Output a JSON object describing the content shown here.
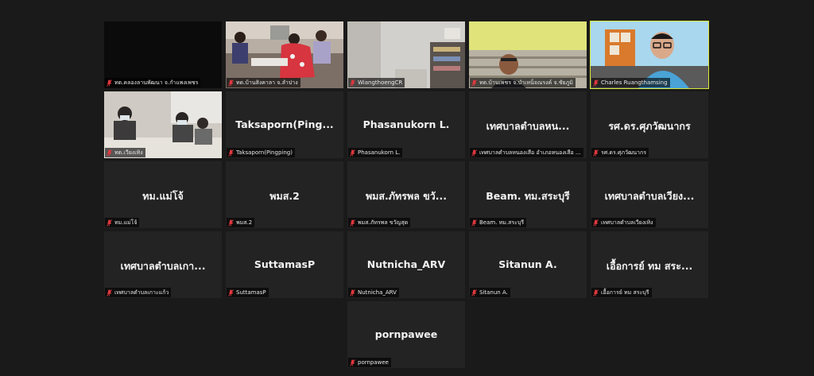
{
  "accent": {
    "speaking_border": "#d9e83a",
    "muted_mic": "#e0383e"
  },
  "participants": [
    {
      "label": "ทต.คลองลานพัฒนา จ.กำแพงเพชร",
      "video": "dark"
    },
    {
      "label": "ทต.บ้านสิงคาลา จ.ลำปาง",
      "video": "room"
    },
    {
      "label": "WiangthoengCR",
      "video": "office"
    },
    {
      "label": "ทต.บ้านเพชร จ.บำเหน็จณรงค์ จ.ชัยภูมิ",
      "video": "man-green-wall"
    },
    {
      "label": "Charles Ruangthamsing",
      "video": "man-glasses"
    },
    {
      "label": "ทต.เวียงเทิง",
      "video": "meeting-room"
    },
    {
      "display_name": "Taksaporn(Ping...",
      "label": "Taksaporn(Pingping)"
    },
    {
      "display_name": "Phasanukorn L.",
      "label": "Phasanukorn L."
    },
    {
      "display_name": "เทศบาลตำบลหน...",
      "label": "เทศบาลตำบลหนองเสือ อำเภอหนองเสือ ..."
    },
    {
      "display_name": "รศ.ดร.ศุภวัฒนากร",
      "label": "รศ.ดร.ศุภวัฒนากร"
    },
    {
      "display_name": "ทม.แม่โจ้",
      "label": "ทม.แม่โจ้"
    },
    {
      "display_name": "พมส.2",
      "label": "พมส.2"
    },
    {
      "display_name": "พมส.ภัทรพล ขวั...",
      "label": "พมส.ภัทรพล ขวัญสุด"
    },
    {
      "display_name": "Beam. ทม.สระบุรี",
      "label": "Beam. ทม.สระบุรี"
    },
    {
      "display_name": "เทศบาลตำบลเวียง...",
      "label": "เทศบาลตำบลเวียงเทิง"
    },
    {
      "display_name": "เทศบาลตำบลเกา...",
      "label": "เทศบาลตำบลเกาะแก้ว"
    },
    {
      "display_name": "SuttamasP",
      "label": "SuttamasP"
    },
    {
      "display_name": "Nutnicha_ARV",
      "label": "Nutnicha_ARV"
    },
    {
      "display_name": "Sitanun A.",
      "label": "Sitanun A."
    },
    {
      "display_name": "เอื้อการย์ ทม สระ...",
      "label": "เอื้อการย์ ทม สระบุรี"
    },
    {
      "display_name": "pornpawee",
      "label": "pornpawee"
    }
  ]
}
